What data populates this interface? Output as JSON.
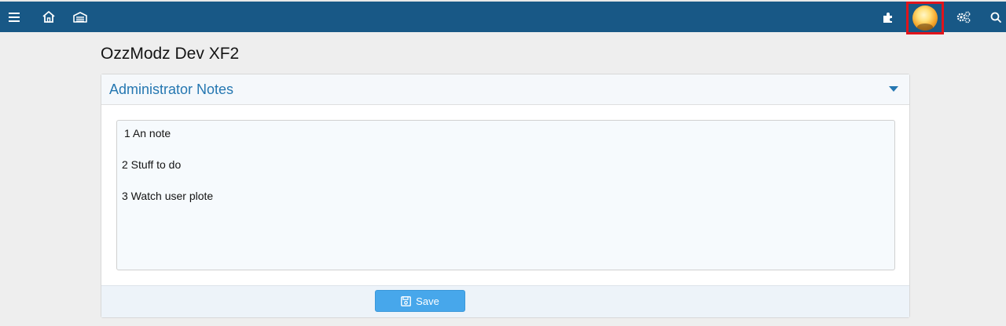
{
  "topbar": {
    "left_icons": [
      "menu-icon",
      "home-icon",
      "garage-icon"
    ],
    "right_icons": [
      "puzzle-icon",
      "avatar",
      "cogs-icon",
      "search-icon"
    ],
    "highlight_color": "#e0141b",
    "bar_color": "#185886"
  },
  "page": {
    "title": "OzzModz Dev XF2"
  },
  "admin_notes": {
    "header": "Administrator Notes",
    "lines": [
      "1 An note",
      "2 Stuff to do",
      "3 Watch user plote"
    ],
    "save_label": "Save"
  }
}
